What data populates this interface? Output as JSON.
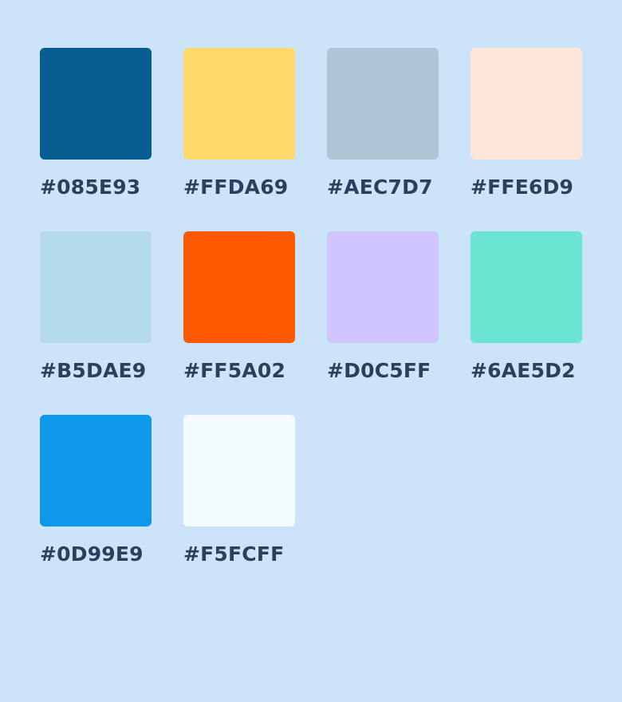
{
  "page": {
    "background": "#CCE4FA",
    "label_color": "#2E3F5C"
  },
  "palette": [
    {
      "hex": "#085E93",
      "label": "#085E93"
    },
    {
      "hex": "#FFDA69",
      "label": "#FFDA69"
    },
    {
      "hex": "#AEC7D7",
      "label": "#AEC7D7"
    },
    {
      "hex": "#FFE6D9",
      "label": "#FFE6D9"
    },
    {
      "hex": "#B5DAE9",
      "label": "#B5DAE9"
    },
    {
      "hex": "#FF5A02",
      "label": "#FF5A02"
    },
    {
      "hex": "#D0C5FF",
      "label": "#D0C5FF"
    },
    {
      "hex": "#6AE5D2",
      "label": "#6AE5D2"
    },
    {
      "hex": "#0D99E9",
      "label": "#0D99E9"
    },
    {
      "hex": "#F5FCFF",
      "label": "#F5FCFF"
    }
  ]
}
